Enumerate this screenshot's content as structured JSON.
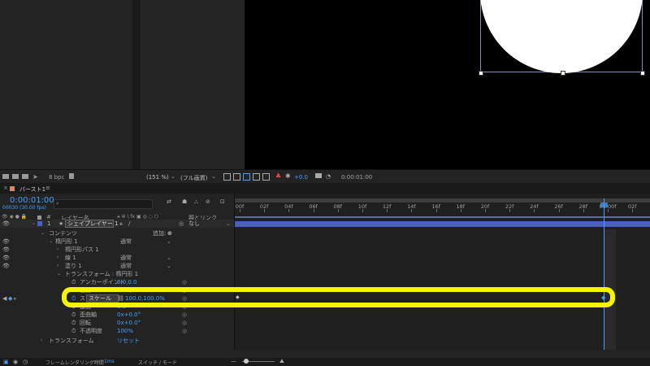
{
  "viewer": {
    "toolbar": {
      "bpc": "8 bpc",
      "zoom": "(151 %)",
      "resolution": "(フル画質)",
      "exposure": "+0.0",
      "timecode": "0:00:01:00"
    }
  },
  "comp": {
    "tab_title": "バースト1"
  },
  "timeline": {
    "current_time": "0:00:01:00",
    "frame_info": "00030 (30.00 fps)",
    "search_placeholder": "",
    "col_layer_name": "レイヤー名",
    "col_parent": "親とリンク",
    "ruler": [
      "00f",
      "02f",
      "04f",
      "06f",
      "08f",
      "10f",
      "12f",
      "14f",
      "16f",
      "18f",
      "20f",
      "22f",
      "24f",
      "26f",
      "28f",
      "01:00f",
      "02f",
      "04f"
    ],
    "layer": {
      "number": "1",
      "name": "シェイプレイヤー 1",
      "parent": "なし"
    },
    "rows": {
      "contents": "コンテンツ",
      "add": "追加:",
      "ellipse": "楕円形 1",
      "ellipse_mode": "通常",
      "ellipse_path": "楕円形パス 1",
      "stroke": "線 1",
      "stroke_mode": "通常",
      "fill": "塗り 1",
      "fill_mode": "通常",
      "transform_group": "トランスフォーム : 楕円形 1",
      "anchor": "アンカーポイント",
      "anchor_val": "0.0,0.0",
      "position": "位置",
      "position_val": "81.5,127.2",
      "scale_prefix": "ス",
      "scale": "スケール",
      "scale_val": "100.0,100.0%",
      "skew": "歪曲",
      "skew_val": "0.0",
      "skew_axis": "歪曲軸",
      "skew_axis_val": "0x+0.0°",
      "rotation": "回転",
      "rotation_val": "0x+0.0°",
      "opacity": "不透明度",
      "opacity_val": "100%",
      "transform": "トランスフォーム",
      "transform_val": "リセット"
    },
    "footer": {
      "render_label": "フレームレンダリング時間",
      "render_time": "1ms",
      "switches": "スイッチ / モード"
    }
  },
  "colors": {
    "accent_blue": "#4a9ff5",
    "highlight_yellow": "#f5f500",
    "layer_bar": "#4b5fbd",
    "playhead": "#4a9ff5"
  }
}
